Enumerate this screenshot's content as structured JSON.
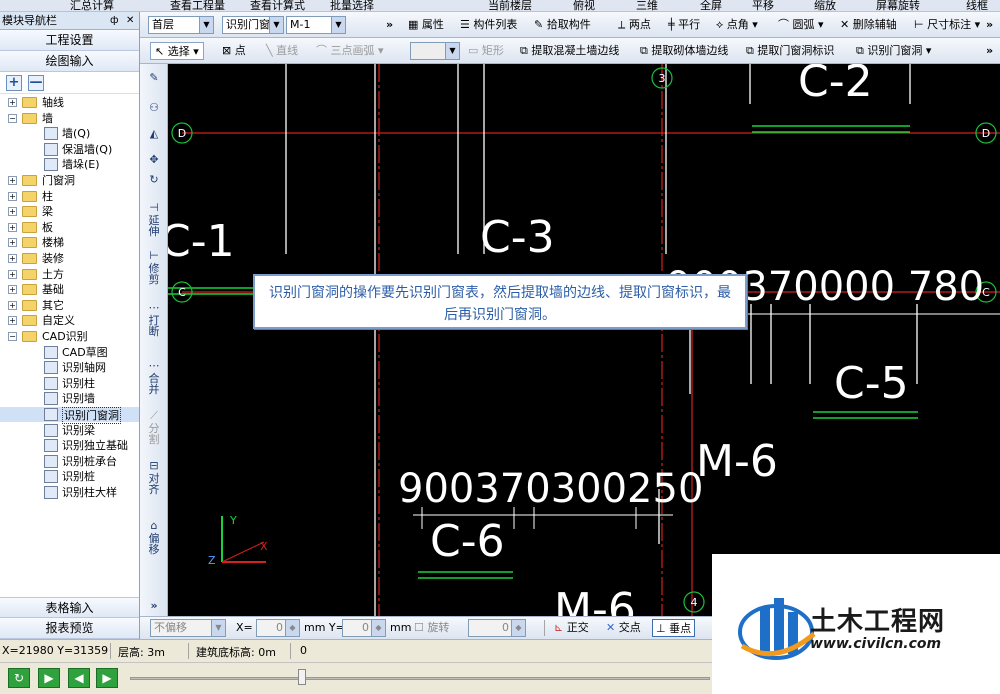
{
  "top_strip": {
    "items": [
      "汇总计算",
      "查看工程量",
      "查看计算式",
      "批量选择",
      "当前楼层",
      "俯视",
      "三维",
      "全屏",
      "平移",
      "缩放",
      "屏幕旋转",
      "线框"
    ]
  },
  "panel": {
    "title": "模块导航栏",
    "pin": "ф",
    "close": "✕",
    "project_settings": "工程设置",
    "drawing_input": "绘图输入",
    "add": "+",
    "remove": "—",
    "table_input": "表格输入",
    "report_preview": "报表预览"
  },
  "tree": [
    {
      "label": "轴线",
      "expander": "+",
      "level": 0
    },
    {
      "label": "墙",
      "expander": "−",
      "level": 0
    },
    {
      "label": "墙(Q)",
      "level": 1
    },
    {
      "label": "保温墙(Q)",
      "level": 1
    },
    {
      "label": "墙垛(E)",
      "level": 1
    },
    {
      "label": "门窗洞",
      "expander": "+",
      "level": 0
    },
    {
      "label": "柱",
      "expander": "+",
      "level": 0
    },
    {
      "label": "梁",
      "expander": "+",
      "level": 0
    },
    {
      "label": "板",
      "expander": "+",
      "level": 0
    },
    {
      "label": "楼梯",
      "expander": "+",
      "level": 0
    },
    {
      "label": "装修",
      "expander": "+",
      "level": 0
    },
    {
      "label": "土方",
      "expander": "+",
      "level": 0
    },
    {
      "label": "基础",
      "expander": "+",
      "level": 0
    },
    {
      "label": "其它",
      "expander": "+",
      "level": 0
    },
    {
      "label": "自定义",
      "expander": "+",
      "level": 0
    },
    {
      "label": "CAD识别",
      "expander": "−",
      "level": 0
    },
    {
      "label": "CAD草图",
      "level": 1
    },
    {
      "label": "识别轴网",
      "level": 1
    },
    {
      "label": "识别柱",
      "level": 1
    },
    {
      "label": "识别墙",
      "level": 1
    },
    {
      "label": "识别门窗洞",
      "level": 1,
      "selected": true
    },
    {
      "label": "识别梁",
      "level": 1
    },
    {
      "label": "识别独立基础",
      "level": 1
    },
    {
      "label": "识别桩承台",
      "level": 1
    },
    {
      "label": "识别桩",
      "level": 1
    },
    {
      "label": "识别柱大样",
      "level": 1
    }
  ],
  "toolbar2": {
    "floor": "首层",
    "category": "识别门窗",
    "element": "M-1",
    "more": "»",
    "properties": "属性",
    "component_list": "构件列表",
    "pick_component": "拾取构件",
    "two_points": "两点",
    "parallel": "平行",
    "point_angle": "点角",
    "arc": "圆弧",
    "delete_aux": "删除辅轴",
    "dimension": "尺寸标注",
    "more2": "»"
  },
  "toolbar3": {
    "select": "选择",
    "point": "点",
    "line": "直线",
    "three_point_arc": "三点画弧",
    "rectangle": "矩形",
    "extract_concrete_wall": "提取混凝土墙边线",
    "extract_masonry_wall": "提取砌体墙边线",
    "extract_opening_label": "提取门窗洞标识",
    "identify_opening": "识别门窗洞",
    "more": "»"
  },
  "vstrip": {
    "extend": "延伸",
    "trim": "修剪",
    "break": "打断",
    "merge": "合并",
    "split": "分割",
    "align": "对齐",
    "offset": "偏移",
    "more": "»"
  },
  "canvas": {
    "axis_labels": [
      "D",
      "D",
      "C",
      "C",
      "3",
      "4"
    ],
    "texts": [
      "C-1",
      "C-3",
      "C-2",
      "C-5",
      "M-6",
      "C-6",
      "M-6"
    ],
    "dims_top": "900370000 780",
    "dims_c6": "900370300250",
    "coord_x": "X",
    "coord_y": "Y",
    "coord_z": "Z"
  },
  "tooltip": {
    "text": "识别门窗洞的操作要先识别门窗表，然后提取墙的边线、提取门窗标识，最后再识别门窗洞。"
  },
  "status1": {
    "no_offset": "不偏移",
    "x_label": "X=",
    "x_value": "0",
    "y_label": "mm  Y=",
    "y_value": "0",
    "unit": "mm",
    "rotate": "旋转",
    "rotate_value": "0",
    "ortho": "正交",
    "intersection": "交点",
    "perpendicular": "垂点"
  },
  "status2": {
    "coords": "X=21980 Y=31359",
    "floor_height": "层高: 3m",
    "base_elevation": "建筑底标高: 0m",
    "value": "0"
  },
  "logo": {
    "title": "土木工程网",
    "url": "www.civilcn.com"
  },
  "colors": {
    "canvas_bg": "#000000",
    "axis_red": "#d42020",
    "axis_bubble": "#1bbf3a",
    "wall_white": "#ffffff",
    "window_green": "#19d23a",
    "tooltip_text": "#2c5ea8"
  }
}
